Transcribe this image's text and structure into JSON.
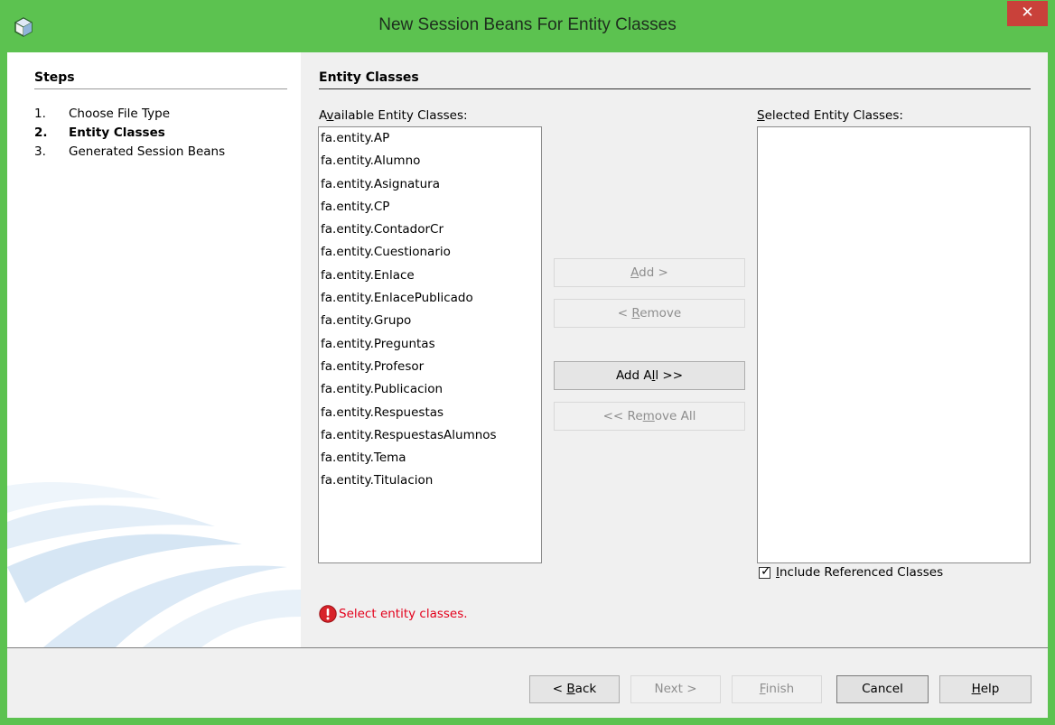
{
  "window": {
    "title": "New Session Beans For Entity Classes",
    "close_glyph": "✕"
  },
  "steps": {
    "heading": "Steps",
    "items": [
      {
        "num": "1.",
        "label": "Choose File Type",
        "active": false
      },
      {
        "num": "2.",
        "label": "Entity Classes",
        "active": true
      },
      {
        "num": "3.",
        "label": "Generated Session Beans",
        "active": false
      }
    ]
  },
  "panel": {
    "heading": "Entity Classes",
    "available_label_pre": "A",
    "available_label_mn": "v",
    "available_label_post": "ailable Entity Classes:",
    "selected_label_pre": "",
    "selected_label_mn": "S",
    "selected_label_post": "elected Entity Classes:",
    "available": [
      "fa.entity.AP",
      "fa.entity.Alumno",
      "fa.entity.Asignatura",
      "fa.entity.CP",
      "fa.entity.ContadorCr",
      "fa.entity.Cuestionario",
      "fa.entity.Enlace",
      "fa.entity.EnlacePublicado",
      "fa.entity.Grupo",
      "fa.entity.Preguntas",
      "fa.entity.Profesor",
      "fa.entity.Publicacion",
      "fa.entity.Respuestas",
      "fa.entity.RespuestasAlumnos",
      "fa.entity.Tema",
      "fa.entity.Titulacion"
    ],
    "selected": [],
    "buttons": {
      "add": {
        "pre": "",
        "mn": "A",
        "post": "dd >",
        "enabled": false
      },
      "remove": {
        "pre": "< ",
        "mn": "R",
        "post": "emove",
        "enabled": false
      },
      "add_all": {
        "pre": "Add A",
        "mn": "l",
        "post": "l >>",
        "enabled": true
      },
      "remove_all": {
        "pre": "<< Re",
        "mn": "m",
        "post": "ove All",
        "enabled": false
      }
    },
    "include_referenced": {
      "checked": true,
      "label_pre": "",
      "label_mn": "I",
      "label_post": "nclude Referenced Classes"
    },
    "error": "Select entity classes.",
    "colors": {
      "error": "#e3001b",
      "titlebar": "#5cc250",
      "close": "#c9413a"
    }
  },
  "footer": {
    "back": {
      "pre": "< ",
      "mn": "B",
      "post": "ack",
      "enabled": true
    },
    "next": {
      "label": "Next >",
      "enabled": false
    },
    "finish": {
      "pre": "",
      "mn": "F",
      "post": "inish",
      "enabled": false
    },
    "cancel": {
      "label": "Cancel",
      "enabled": true
    },
    "help": {
      "pre": "",
      "mn": "H",
      "post": "elp",
      "enabled": true
    }
  }
}
